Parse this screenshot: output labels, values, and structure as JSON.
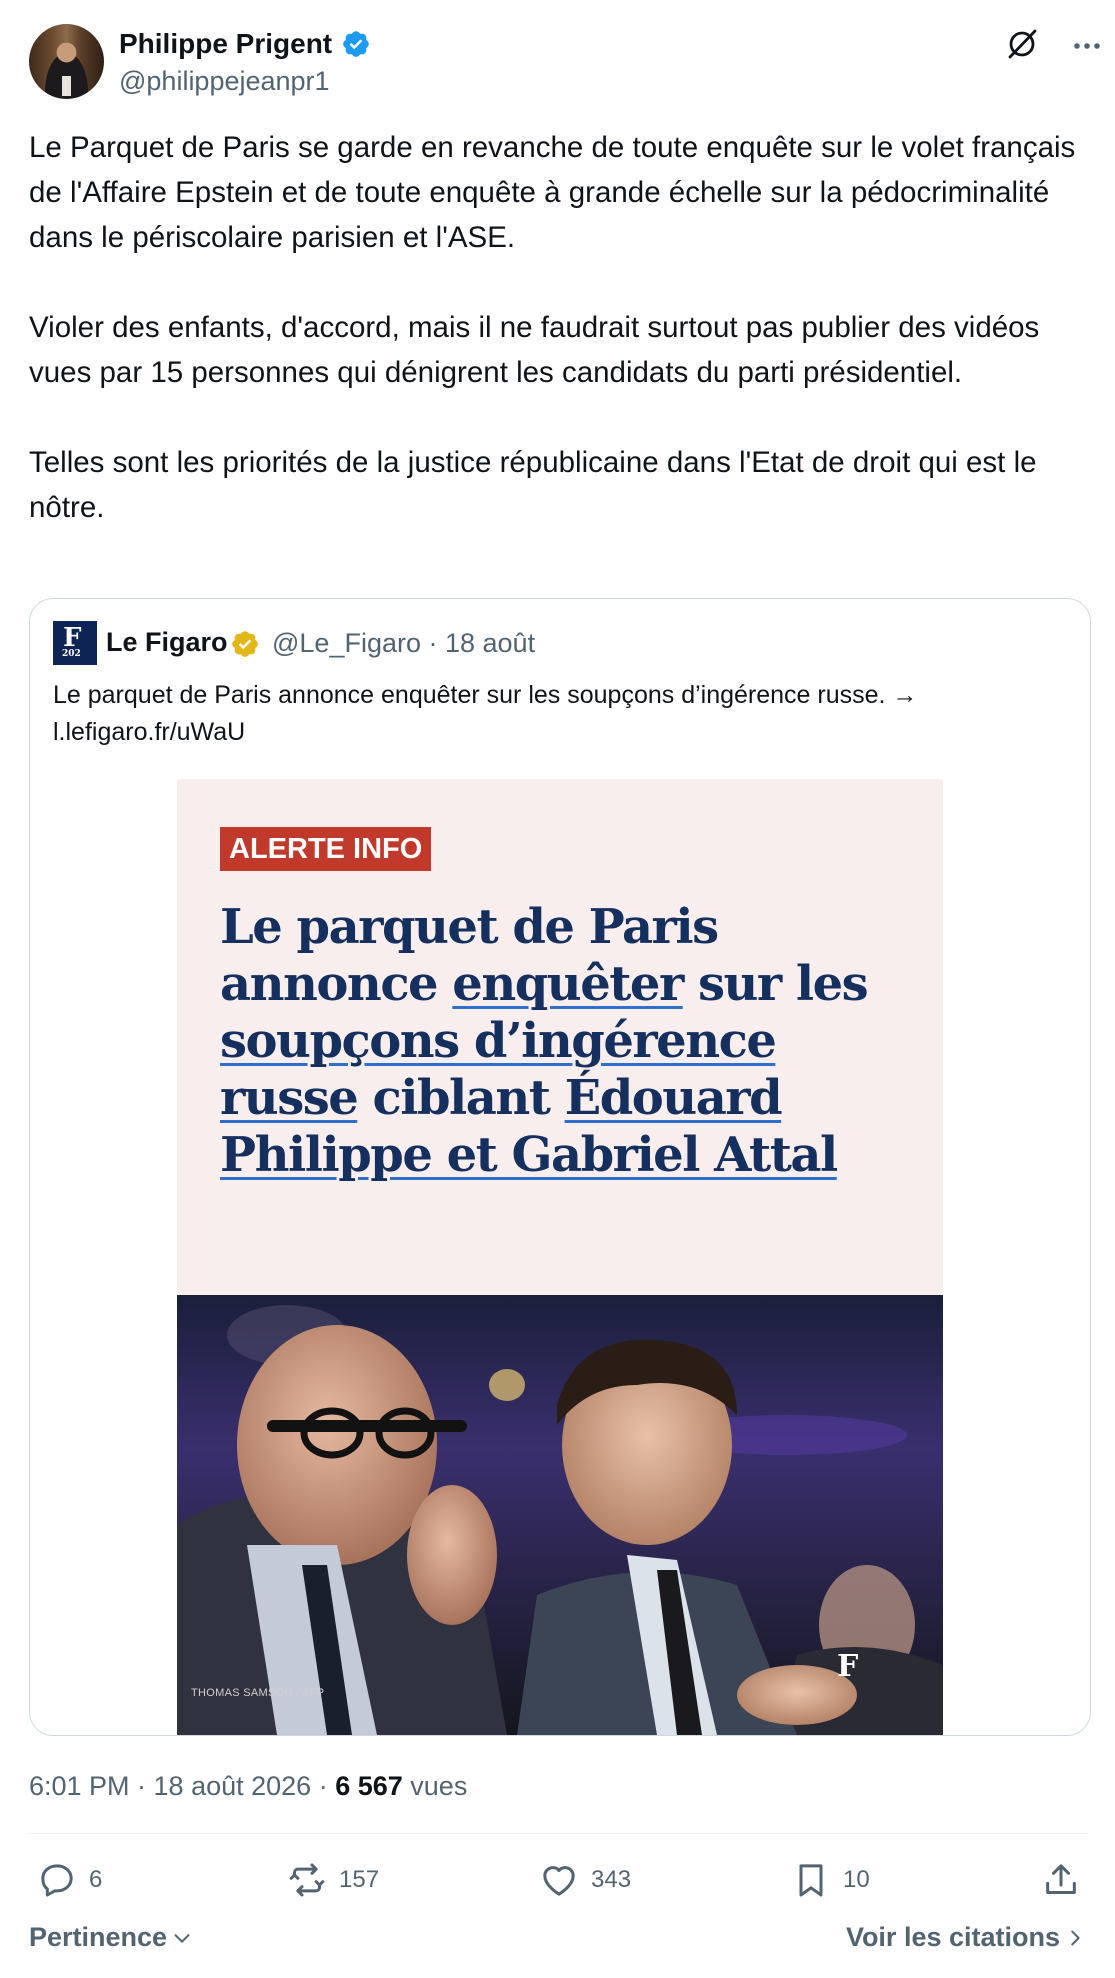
{
  "tweet": {
    "author_name": "Philippe Prigent",
    "handle": "@philippejeanpr1",
    "paragraphs": [
      "Le Parquet de Paris se garde en revanche de toute enquête sur le volet français de l'Affaire Epstein et de toute enquête à grande échelle sur la pédocriminalité dans le périscolaire parisien et l'ASE.",
      "Violer des enfants, d'accord, mais il ne faudrait surtout pas publier des vidéos vues par 15 personnes qui dénigrent les candidats du parti présidentiel.",
      "Telles sont les priorités de la justice républicaine dans l'Etat de droit qui est le nôtre."
    ],
    "time": "6:01 PM · 18 août 2026 · ",
    "views_count": "6 567",
    "views_label": " vues"
  },
  "quote": {
    "logo_letter": "F",
    "logo_year": "202",
    "name": "Le Figaro",
    "handle_date": "@Le_Figaro · 18 août",
    "text": "Le parquet de Paris annonce enquêter sur les soupçons d’ingérence russe. → l.lefigaro.fr/uWaU",
    "media": {
      "badge": "ALERTE INFO",
      "headline": {
        "p1": "Le parquet de Paris annonce ",
        "u1": "enquêter",
        "p2": " sur les ",
        "u2": "soupçons d’ingérence russe",
        "p3": " ciblant ",
        "u3": "Édouard Philippe et Gabriel Attal"
      },
      "credit": "THOMAS SAMSON / AFP",
      "watermark": "F"
    }
  },
  "actions": {
    "replies": "6",
    "reposts": "157",
    "likes": "343",
    "bookmarks": "10"
  },
  "footer": {
    "sort_label": "Pertinence",
    "quotes_label": "Voir les citations"
  },
  "colors": {
    "verified_blue": "#1d9bf0",
    "verified_gold": "#e2b719",
    "headline_navy": "#15305e",
    "alert_red": "#c0392b",
    "secondary_text": "#536471"
  }
}
